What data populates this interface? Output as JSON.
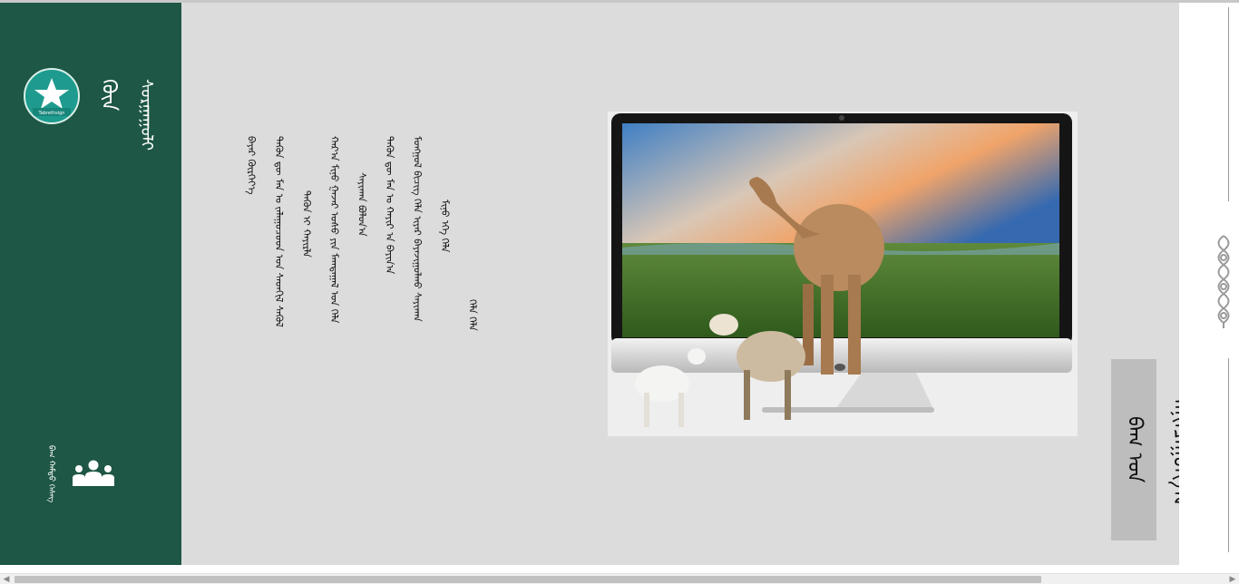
{
  "sidebar": {
    "logo_text": "Tabrethsign",
    "brand_line_1": "ᠬᠦᠨ",
    "brand_line_2": "ᠰᠤᠷᠭᠠᠭᠤᠯᠢ",
    "team_label": "ᠪᠠᠭ ᠬᠠᠮᠲᠤ ᠬᠡᠰᠡᠭ",
    "team_icon": "users-icon"
  },
  "poem": {
    "lines": [
      "ᠬᠡᠯᠡ ᠬᠡᠯᠡ",
      "ᠮᠢᠨᠤ ᠡᠭᠡ ᠬᠡᠯᠡ",
      "ᠮᠤᠩᠭᠤᠯ ᠪᠢᠴᠢᠭ ᠬᠡᠯᠡ ᠢᠶᠠᠷ ᠪᠠᠶᠠᠵᠢᠭᠤᠯᠬᠤ ᠰᠠᠶᠢᠬᠠᠨ",
      "ᠲᠡᠭᠦᠨ ᠳᠦ ᠮᠠᠨ ᠤ ᠬᠠᠶᠢᠷ ᠠ ᠪᠠᠶᠢᠨ᠎ᠠ",
      "ᠰᠠᠶᠢᠬᠠᠨ ᠪᠤᠯᠤᠨ᠎ᠠ",
      "ᠬᠠᠷ᠎ᠠ ᠮᠢᠨᠤ ᠭᠠᠵᠠᠷ ᠤᠰᠤ ᠶᠢᠨ ᠮᠠᠭᠲᠠᠭᠠᠯ ᠤᠨ ᠬᠡᠯᠡ",
      "ᠲᠡᠭᠦᠨ ᠢ ᠬᠠᠶᠢᠷᠯᠠ",
      "ᠲᠡᠭᠦᠨ ᠳᠦ ᠮᠠᠨ ᠤ ᠵᠠᠯᠠᠭᠤᠴᠤᠳ ᠤᠨ ᠰᠡᠳᠬᠢᠯ ᠰᠡᠭᠦᠯ",
      "ᠪᠠᠶᠠᠷ ᠬᠦᠷᠭᠡᠶ᠎ᠡ"
    ]
  },
  "hero": {
    "illustration": "monitor-with-camel-and-sheep"
  },
  "badge": {
    "text": "ᠪᠠᠭ ᠤᠨ ᠲᠠᠨᠢᠯᠴᠠᠭᠤᠯᠭ᠎ᠠ"
  },
  "right_panel": {
    "ornament_icon": "mongolian-knot-ornament-icon"
  },
  "scrollbar": {
    "left_arrow": "◀",
    "right_arrow": "▶"
  },
  "colors": {
    "sidebar_bg": "#1e5745",
    "main_bg": "#dcdcdc",
    "logo_bg": "#1e9b8e",
    "badge_bg": "#bdbdbd"
  }
}
